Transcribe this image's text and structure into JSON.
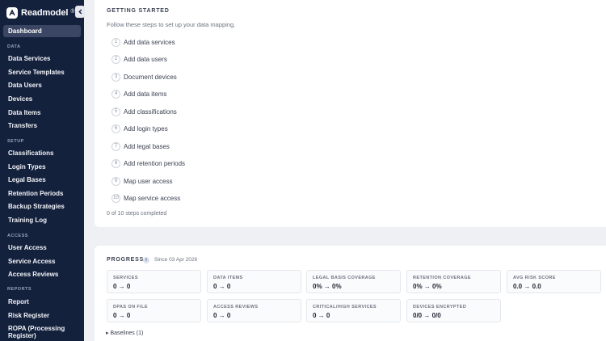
{
  "app": {
    "name": "Readmodel",
    "reg_mark": "®"
  },
  "sidebar": {
    "active": "Dashboard",
    "sections": [
      {
        "title": "DATA",
        "items": [
          "Data Services",
          "Service Templates",
          "Data Users",
          "Devices",
          "Data Items",
          "Transfers"
        ]
      },
      {
        "title": "SETUP",
        "items": [
          "Classifications",
          "Login Types",
          "Legal Bases",
          "Retention Periods",
          "Backup Strategies",
          "Training Log"
        ]
      },
      {
        "title": "ACCESS",
        "items": [
          "User Access",
          "Service Access",
          "Access Reviews"
        ]
      },
      {
        "title": "REPORTS",
        "items": [
          "Report",
          "Risk Register",
          "ROPA (Processing Register)"
        ]
      }
    ]
  },
  "getting_started": {
    "title": "GETTING STARTED",
    "subtitle": "Follow these steps to set up your data mapping.",
    "steps": [
      {
        "num": "1",
        "label": "Add data services"
      },
      {
        "num": "2",
        "label": "Add data users"
      },
      {
        "num": "3",
        "label": "Document devices"
      },
      {
        "num": "4",
        "label": "Add data items"
      },
      {
        "num": "5",
        "label": "Add classifications"
      },
      {
        "num": "6",
        "label": "Add login types"
      },
      {
        "num": "7",
        "label": "Add legal bases"
      },
      {
        "num": "8",
        "label": "Add retention periods"
      },
      {
        "num": "9",
        "label": "Map user access"
      },
      {
        "num": "10",
        "label": "Map service access"
      }
    ],
    "completed": "0 of 10 steps completed"
  },
  "progress": {
    "title": "PROGRESS",
    "info": "i",
    "since": "Since 03 Apr 2026",
    "cards": [
      {
        "label": "SERVICES",
        "value": "0 → 0"
      },
      {
        "label": "DATA ITEMS",
        "value": "0 → 0"
      },
      {
        "label": "LEGAL BASIS COVERAGE",
        "value": "0% → 0%"
      },
      {
        "label": "RETENTION COVERAGE",
        "value": "0% → 0%"
      },
      {
        "label": "AVG RISK SCORE",
        "value": "0.0 → 0.0"
      },
      {
        "label": "DPAS ON FILE",
        "value": "0 → 0"
      },
      {
        "label": "ACCESS REVIEWS",
        "value": "0 → 0"
      },
      {
        "label": "CRITICAL/HIGH SERVICES",
        "value": "0 → 0"
      },
      {
        "label": "DEVICES ENCRYPTED",
        "value": "0/0 → 0/0"
      }
    ],
    "baselines": "▸ Baselines (1)"
  }
}
